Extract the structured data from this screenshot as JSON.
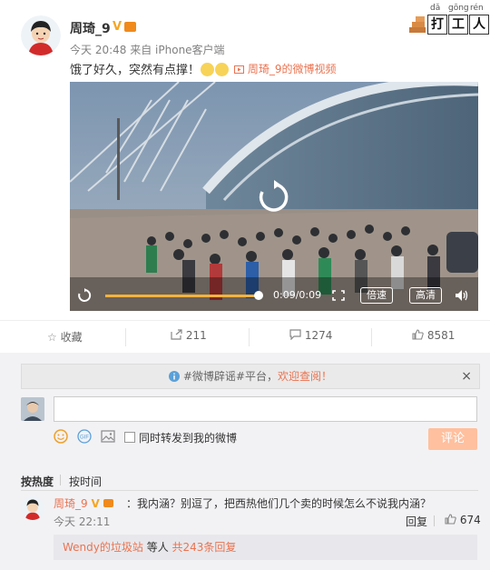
{
  "post": {
    "username": "周琦_9",
    "verified_badge": "V",
    "time": "今天 20:48",
    "source": "来自 iPhone客户端",
    "text": "饿了好久，突然有点撑！",
    "video_link": "周琦_9的微博视频"
  },
  "logo": {
    "pinyin": [
      "dǎ",
      "gōng",
      "rén"
    ],
    "chars": [
      "打",
      "工",
      "人"
    ]
  },
  "video": {
    "time": "0:09/0:09",
    "progress": 1.0,
    "speed_label": "倍速",
    "quality_label": "高清"
  },
  "actions": {
    "collect": "收藏",
    "forward": "211",
    "comments": "1274",
    "likes": "8581"
  },
  "notice": {
    "text_prefix": "#微博辟谣#平台，",
    "link_text": "欢迎查阅！",
    "close": "×"
  },
  "composer": {
    "forward_label": "同时转发到我的微博",
    "submit_label": "评论"
  },
  "sort": {
    "by_hot": "按热度",
    "by_time": "按时间"
  },
  "comment": {
    "username": "周琦_9",
    "text": "：我内涵？别逗了，把西热他们几个卖的时候怎么不说我内涵？",
    "time": "今天 22:11",
    "reply_label": "回复",
    "likes": "674",
    "replies_user": "Wendy的垃圾站",
    "replies_mid": " 等人 ",
    "replies_count": "共243条回复"
  },
  "colors": {
    "accent": "#eb7350",
    "submit_disabled": "#ffc09f",
    "comment_bg": "#f2f2f5"
  }
}
